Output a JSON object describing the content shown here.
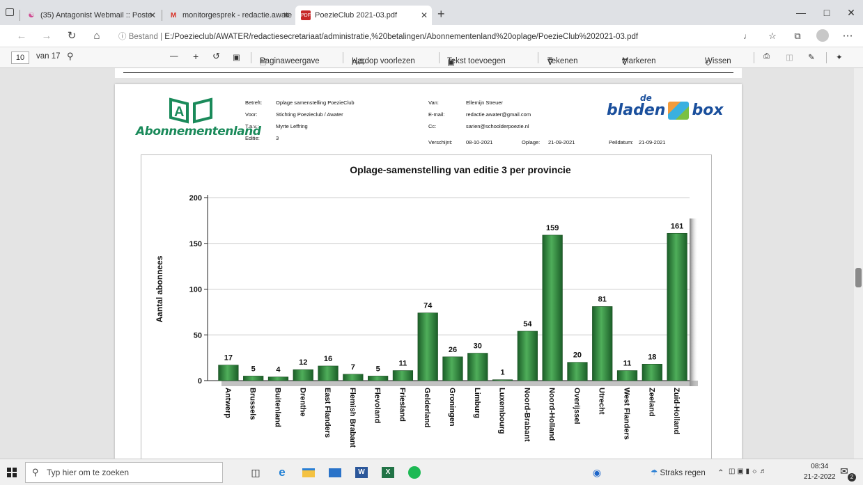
{
  "browser": {
    "tabs": [
      {
        "label": "(35) Antagonist Webmail :: Poste",
        "icon": "webmail-icon"
      },
      {
        "label": "monitorgesprek - redactie.awate",
        "icon": "gmail-icon"
      },
      {
        "label": "PoezieClub 2021-03.pdf",
        "icon": "pdf-icon",
        "active": true
      }
    ],
    "address_prefix": "Bestand",
    "address": "E:/Poezieclub/AWATER/redactiesecretariaat/administratie,%20betalingen/Abonnementenland%20oplage/PoezieClub%202021-03.pdf"
  },
  "pdf_toolbar": {
    "page_number": "10",
    "page_total": "van 17",
    "zoom_minus": "—",
    "zoom_plus": "+",
    "page_view": "Paginaweergave",
    "read_aloud": "Hardop voorlezen",
    "add_text": "Tekst toevoegen",
    "draw": "Tekenen",
    "highlight": "Markeren",
    "erase": "Wissen"
  },
  "document": {
    "logo_left": "Abonnementenland",
    "logo_right_main": "bladen",
    "logo_right_de": "de",
    "logo_right_box": "box",
    "fields": {
      "betreft_label": "Betreft:",
      "betreft": "Oplage samenstelling PoezieClub",
      "voor_label": "Voor:",
      "voor": "Stichting Poezieclub / Awater",
      "tav_label": "T.a.v.:",
      "tav": "Myrte Leffring",
      "editie_label": "Editie:",
      "editie": "3",
      "van_label": "Van:",
      "van": "Ellemijn Streuer",
      "email_label": "E-mail:",
      "email": "redactie.awater@gmail.com",
      "cc_label": "Cc:",
      "cc": "sarien@schoolderpoezie.nl",
      "verschijnt_label": "Verschijnt:",
      "verschijnt": "08-10-2021",
      "oplage_label": "Oplage:",
      "oplage": "21-09-2021",
      "peildatum_label": "Peildatum:",
      "peildatum": "21-09-2021"
    }
  },
  "chart_data": {
    "type": "bar",
    "title": "Oplage-samenstelling van editie 3 per provincie",
    "ylabel": "Aantal abonnees",
    "xlabel": "",
    "ylim": [
      0,
      200
    ],
    "yticks": [
      0,
      50,
      100,
      150,
      200
    ],
    "categories": [
      "Antwerp",
      "Brussels",
      "Buitenland",
      "Drenthe",
      "East Flanders",
      "Flemish Brabant",
      "Flevoland",
      "Friesland",
      "Gelderland",
      "Groningen",
      "Limburg",
      "Luxembourg",
      "Noord-Brabant",
      "Noord-Holland",
      "Overijssel",
      "Utrecht",
      "West Flanders",
      "Zeeland",
      "Zuid-Holland"
    ],
    "values": [
      17,
      5,
      4,
      12,
      16,
      7,
      5,
      11,
      74,
      26,
      30,
      1,
      54,
      159,
      20,
      81,
      11,
      18,
      161
    ],
    "bar_color": "#2e8b3e",
    "grid": true
  },
  "taskbar": {
    "search_placeholder": "Typ hier om te zoeken",
    "weather": "Straks regen",
    "time": "08:34",
    "date": "21-2-2022",
    "notifications": "2"
  }
}
